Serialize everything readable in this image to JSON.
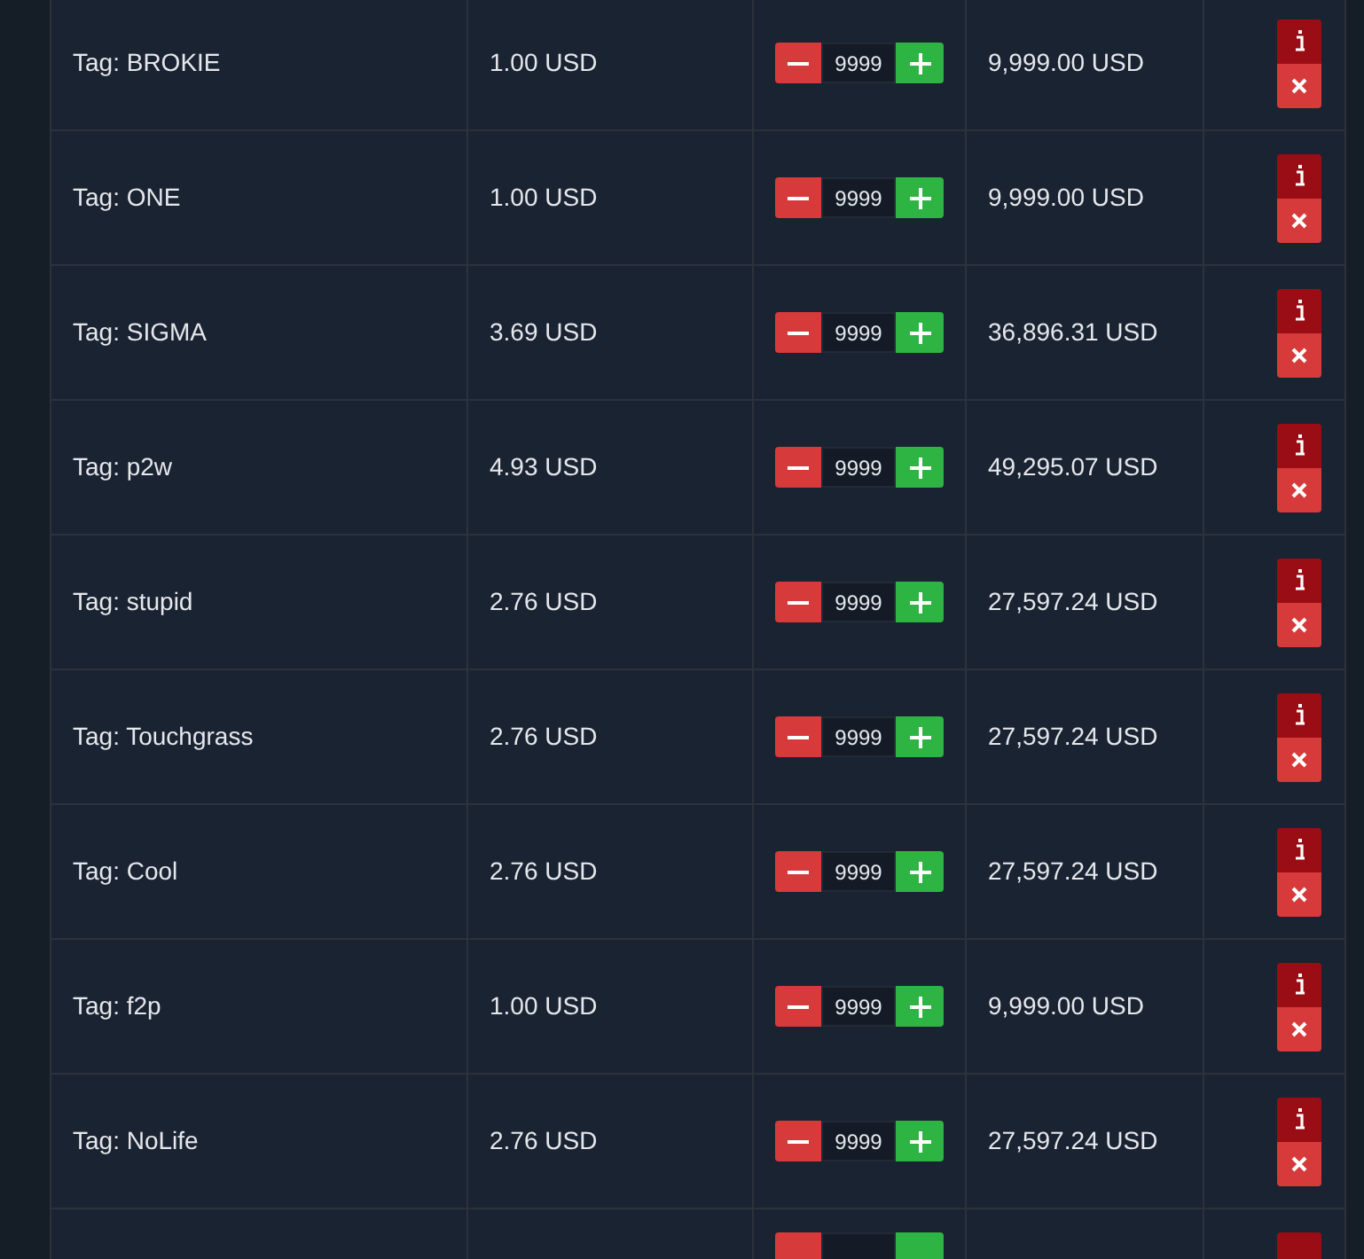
{
  "rows": [
    {
      "item": "Tag: BROKIE",
      "price": "1.00 USD",
      "quantity": "9999",
      "total": "9,999.00 USD"
    },
    {
      "item": "Tag: ONE",
      "price": "1.00 USD",
      "quantity": "9999",
      "total": "9,999.00 USD"
    },
    {
      "item": "Tag: SIGMA",
      "price": "3.69 USD",
      "quantity": "9999",
      "total": "36,896.31 USD"
    },
    {
      "item": "Tag: p2w",
      "price": "4.93 USD",
      "quantity": "9999",
      "total": "49,295.07 USD"
    },
    {
      "item": "Tag: stupid",
      "price": "2.76 USD",
      "quantity": "9999",
      "total": "27,597.24 USD"
    },
    {
      "item": "Tag: Touchgrass",
      "price": "2.76 USD",
      "quantity": "9999",
      "total": "27,597.24 USD"
    },
    {
      "item": "Tag: Cool",
      "price": "2.76 USD",
      "quantity": "9999",
      "total": "27,597.24 USD"
    },
    {
      "item": "Tag: f2p",
      "price": "1.00 USD",
      "quantity": "9999",
      "total": "9,999.00 USD"
    },
    {
      "item": "Tag: NoLife",
      "price": "2.76 USD",
      "quantity": "9999",
      "total": "27,597.24 USD"
    }
  ]
}
